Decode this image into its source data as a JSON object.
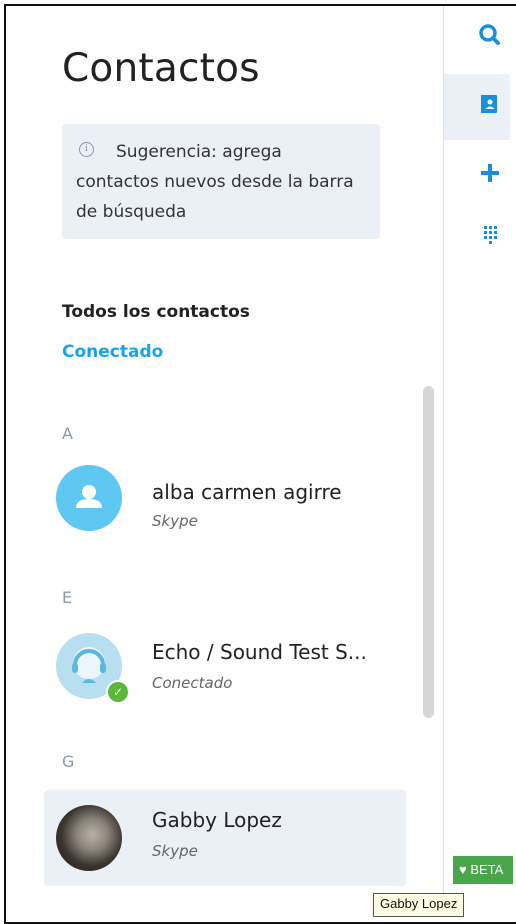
{
  "header": {
    "title": "Contactos"
  },
  "tip": {
    "icon": "info-icon",
    "text": "Sugerencia: agrega contactos nuevos desde la barra de búsqueda"
  },
  "filters": {
    "section": "Todos los contactos",
    "active": "Conectado"
  },
  "groups": [
    {
      "letter": "A",
      "contacts": [
        {
          "name": "alba carmen agirre",
          "sub": "Skype",
          "avatar": "default-person-icon"
        }
      ]
    },
    {
      "letter": "E",
      "contacts": [
        {
          "name": "Echo / Sound Test S...",
          "sub": "Conectado",
          "avatar": "headset-bot-icon",
          "status": "online"
        }
      ]
    },
    {
      "letter": "G",
      "contacts": [
        {
          "name": "Gabby Lopez",
          "sub": "Skype",
          "avatar": "photo",
          "selected": true
        }
      ]
    }
  ],
  "rail": [
    {
      "icon": "search-icon"
    },
    {
      "icon": "contacts-icon",
      "active": true
    },
    {
      "icon": "add-icon"
    },
    {
      "icon": "dialpad-icon"
    }
  ],
  "beta": {
    "label": "BETA"
  },
  "tooltip": {
    "text": "Gabby Lopez"
  },
  "colors": {
    "accent": "#1aa3e8",
    "online": "#5bb83a",
    "beta": "#49a64a"
  }
}
